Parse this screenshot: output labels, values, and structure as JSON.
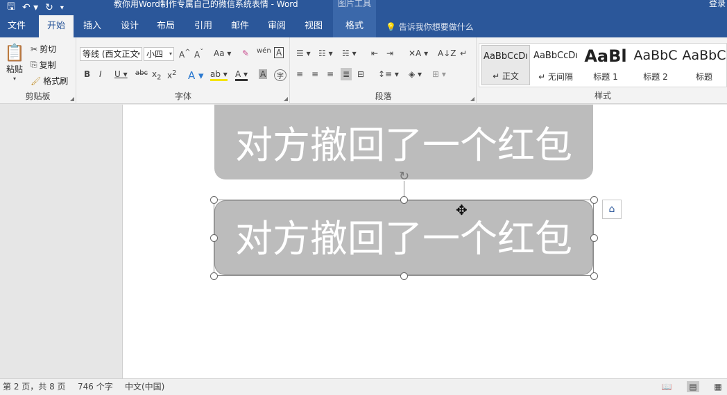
{
  "titlebar": {
    "title": "教你用Word制作专属自己的微信系统表情  -  Word",
    "context_tab": "图片工具",
    "login": "登录"
  },
  "tabs": [
    {
      "label": "文件"
    },
    {
      "label": "开始"
    },
    {
      "label": "插入"
    },
    {
      "label": "设计"
    },
    {
      "label": "布局"
    },
    {
      "label": "引用"
    },
    {
      "label": "邮件"
    },
    {
      "label": "审阅"
    },
    {
      "label": "视图"
    },
    {
      "label": "格式"
    }
  ],
  "tellme": "告诉我你想要做什么",
  "clipboard": {
    "paste": "粘贴",
    "cut": "剪切",
    "copy": "复制",
    "format_painter": "格式刷",
    "label": "剪贴板"
  },
  "font": {
    "name": "等线 (西文正文",
    "size": "小四",
    "label": "字体"
  },
  "paragraph": {
    "label": "段落"
  },
  "styles": {
    "label": "样式",
    "items": [
      {
        "preview": "AaBbCcDı",
        "name": "↵ 正文"
      },
      {
        "preview": "AaBbCcDı",
        "name": "↵ 无间隔"
      },
      {
        "preview": "AaBl",
        "name": "标题 1"
      },
      {
        "preview": "AaBbC",
        "name": "标题 2"
      },
      {
        "preview": "AaBbC",
        "name": "标题"
      }
    ]
  },
  "document": {
    "bubble_text_1": "对方撤回了一个红包",
    "bubble_text_2": "对方撤回了一个红包"
  },
  "status": {
    "page": "第 2 页，共 8 页",
    "words": "746 个字",
    "language": "中文(中国)"
  }
}
